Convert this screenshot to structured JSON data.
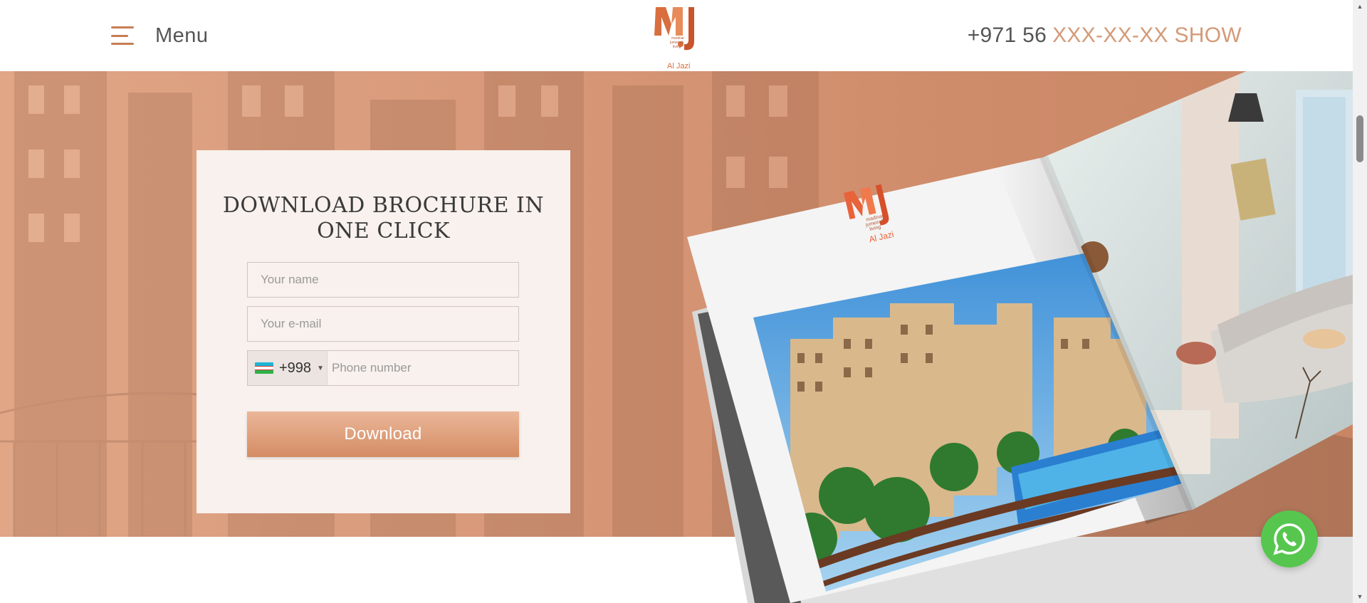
{
  "header": {
    "menu_label": "Menu",
    "logo_caption": "Al Jazi",
    "logo_lines": [
      "madinat",
      "jumeirah",
      "living"
    ],
    "phone_prefix": "+971 56",
    "phone_hidden": "XXX-XX-XX SHOW"
  },
  "form": {
    "title_line1": "DOWNLOAD BROCHURE IN",
    "title_line2": "ONE CLICK",
    "name_placeholder": "Your name",
    "email_placeholder": "Your e-mail",
    "country_code": "+998",
    "phone_placeholder": "Phone number",
    "submit_label": "Download"
  },
  "brochure": {
    "logo_caption": "Al Jazi",
    "logo_lines": [
      "madinat",
      "jumeirah",
      "living"
    ]
  },
  "colors": {
    "accent": "#d96e3f",
    "hero_bg": "#d89a7a",
    "button": "#d48c65",
    "whatsapp": "#56c64f"
  },
  "icons": {
    "menu": "hamburger-icon",
    "flag": "uzbekistan-flag-icon",
    "whatsapp": "whatsapp-icon"
  }
}
